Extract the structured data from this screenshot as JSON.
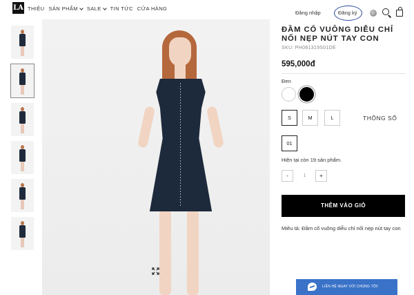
{
  "header": {
    "logo_text": "LA",
    "nav": [
      {
        "label": "THIỆU",
        "has_dropdown": false
      },
      {
        "label": "SẢN PHẨM",
        "has_dropdown": true
      },
      {
        "label": "SALE",
        "has_dropdown": true
      },
      {
        "label": "TIN TỨC",
        "has_dropdown": false
      },
      {
        "label": "CỬA HÀNG",
        "has_dropdown": false
      }
    ],
    "login_label": "Đăng nhập",
    "register_label": "Đăng ký",
    "icons": [
      "globe-icon",
      "search-icon",
      "cart-icon"
    ],
    "annotation_color": "#2a4a9a"
  },
  "gallery": {
    "thumbnail_count": 6,
    "active_index": 1,
    "expand_icon": "expand-icon"
  },
  "product": {
    "title": "ĐẦM CỔ VUÔNG DIỄU CHỈ NỐI NẸP NÚT TAY CON",
    "sku": "SKU: PH081319S01DE",
    "price": "595,000đ",
    "color_label": "Đen",
    "colors": [
      {
        "name": "white",
        "hex": "#ffffff",
        "selected": false
      },
      {
        "name": "black",
        "hex": "#000000",
        "selected": true
      }
    ],
    "sizes": [
      {
        "label": "S",
        "selected": true
      },
      {
        "label": "M",
        "selected": false
      },
      {
        "label": "L",
        "selected": false
      }
    ],
    "size_guide_label": "THÔNG SỐ",
    "variant_label": "01",
    "stock_text": "Hiện tại còn 19 sản phẩm.",
    "qty_minus": "-",
    "qty_value": "1",
    "qty_plus": "+",
    "add_to_cart_label": "THÊM VÀO GIỎ",
    "description": "Miêu tả: Đầm cổ vuông diễu chỉ nối nẹp nút tay con"
  },
  "messenger": {
    "label": "LIÊN HỆ NGAY VỚI CHÚNG TÔI!",
    "color": "#3a72c8"
  }
}
